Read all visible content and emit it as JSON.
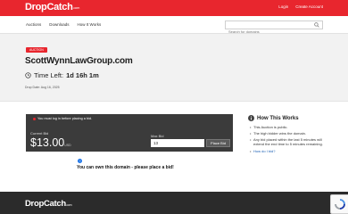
{
  "header": {
    "logo": "DropCatch",
    "logo_suffix": ".com",
    "login": "Login",
    "create_account": "Create Account",
    "accent_color": "#e8262e"
  },
  "nav": {
    "items": [
      "Auctions",
      "Downloads",
      "How It Works"
    ],
    "search_placeholder": "Search for domains"
  },
  "auction": {
    "badge": "AUCTION",
    "domain": "ScottWynnLawGroup.com",
    "time_left_label": "Time Left:",
    "time_left_value": "1d 16h 1m",
    "drop_date": "Drop Date: Aug 16, 2025"
  },
  "bid": {
    "alert": "You must log in before placing a bid.",
    "current_bid_label": "Current Bid",
    "current_bid": "$13.00",
    "currency": "USD",
    "max_bid_label": "Max Bid",
    "max_bid_value": "13",
    "place_bid_button": "Place Bid"
  },
  "promo": {
    "text": "You can own this domain - please place a bid!"
  },
  "how_it_works": {
    "title": "How This Works",
    "items": [
      "This Auction is public.",
      "The high bidder wins the domain.",
      "Any bid placed within the last 5 minutes will extend the end time to 5 minutes remaining.",
      "How do I bid?"
    ]
  },
  "footer": {
    "logo": "DropCatch",
    "logo_suffix": ".com"
  }
}
